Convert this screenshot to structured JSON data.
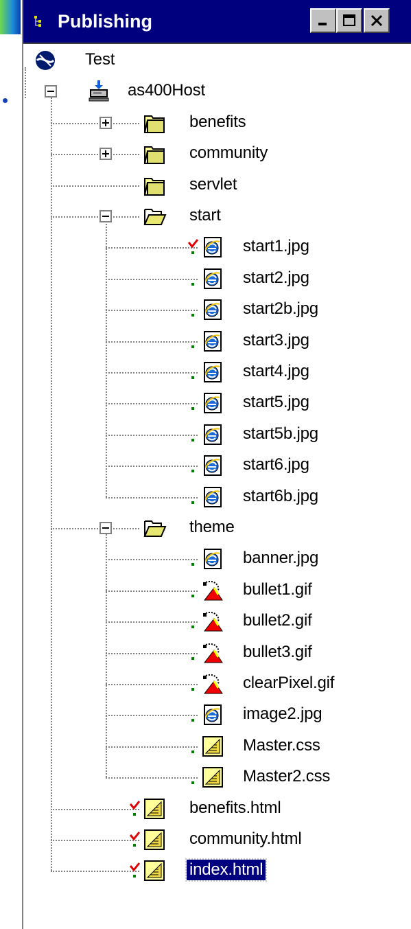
{
  "window": {
    "title": "Publishing",
    "buttons": [
      "minimize",
      "maximize",
      "close"
    ]
  },
  "tree": [
    {
      "label": "Test",
      "icon": "globe-icon",
      "depth": 0
    },
    {
      "label": "as400Host",
      "icon": "host-computer-icon",
      "depth": 0,
      "expander": "minus"
    },
    {
      "label": "benefits",
      "icon": "folder-closed-icon",
      "depth": 1,
      "expander": "plus"
    },
    {
      "label": "community",
      "icon": "folder-closed-icon",
      "depth": 1,
      "expander": "plus"
    },
    {
      "label": "servlet",
      "icon": "folder-closed-icon",
      "depth": 1
    },
    {
      "label": "start",
      "icon": "folder-open-icon",
      "depth": 1,
      "expander": "minus"
    },
    {
      "label": "start1.jpg",
      "icon": "jpg-file-icon",
      "depth": 2,
      "status": "changed"
    },
    {
      "label": "start2.jpg",
      "icon": "jpg-file-icon",
      "depth": 2,
      "status": "published"
    },
    {
      "label": "start2b.jpg",
      "icon": "jpg-file-icon",
      "depth": 2,
      "status": "published"
    },
    {
      "label": "start3.jpg",
      "icon": "jpg-file-icon",
      "depth": 2,
      "status": "published"
    },
    {
      "label": "start4.jpg",
      "icon": "jpg-file-icon",
      "depth": 2,
      "status": "published"
    },
    {
      "label": "start5.jpg",
      "icon": "jpg-file-icon",
      "depth": 2,
      "status": "published"
    },
    {
      "label": "start5b.jpg",
      "icon": "jpg-file-icon",
      "depth": 2,
      "status": "published"
    },
    {
      "label": "start6.jpg",
      "icon": "jpg-file-icon",
      "depth": 2,
      "status": "published"
    },
    {
      "label": "start6b.jpg",
      "icon": "jpg-file-icon",
      "depth": 2,
      "status": "published"
    },
    {
      "label": "theme",
      "icon": "folder-open-icon",
      "depth": 1,
      "expander": "minus"
    },
    {
      "label": "banner.jpg",
      "icon": "jpg-file-icon",
      "depth": 2,
      "status": "published"
    },
    {
      "label": "bullet1.gif",
      "icon": "gif-file-icon",
      "depth": 2,
      "status": "published"
    },
    {
      "label": "bullet2.gif",
      "icon": "gif-file-icon",
      "depth": 2,
      "status": "published"
    },
    {
      "label": "bullet3.gif",
      "icon": "gif-file-icon",
      "depth": 2,
      "status": "published"
    },
    {
      "label": "clearPixel.gif",
      "icon": "gif-file-icon",
      "depth": 2,
      "status": "published"
    },
    {
      "label": "image2.jpg",
      "icon": "jpg-file-icon",
      "depth": 2,
      "status": "published"
    },
    {
      "label": "Master.css",
      "icon": "css-file-icon",
      "depth": 2,
      "status": "published"
    },
    {
      "label": "Master2.css",
      "icon": "css-file-icon",
      "depth": 2,
      "status": "published"
    },
    {
      "label": "benefits.html",
      "icon": "html-file-icon",
      "depth": 1,
      "status": "changed"
    },
    {
      "label": "community.html",
      "icon": "html-file-icon",
      "depth": 1,
      "status": "changed"
    },
    {
      "label": "index.html",
      "icon": "html-file-icon",
      "depth": 1,
      "status": "changed",
      "selected": true
    }
  ],
  "colors": {
    "title_bar": "#00007e",
    "selection": "#00007e",
    "changed_mark": "#e00000",
    "published_mark": "#008000"
  }
}
